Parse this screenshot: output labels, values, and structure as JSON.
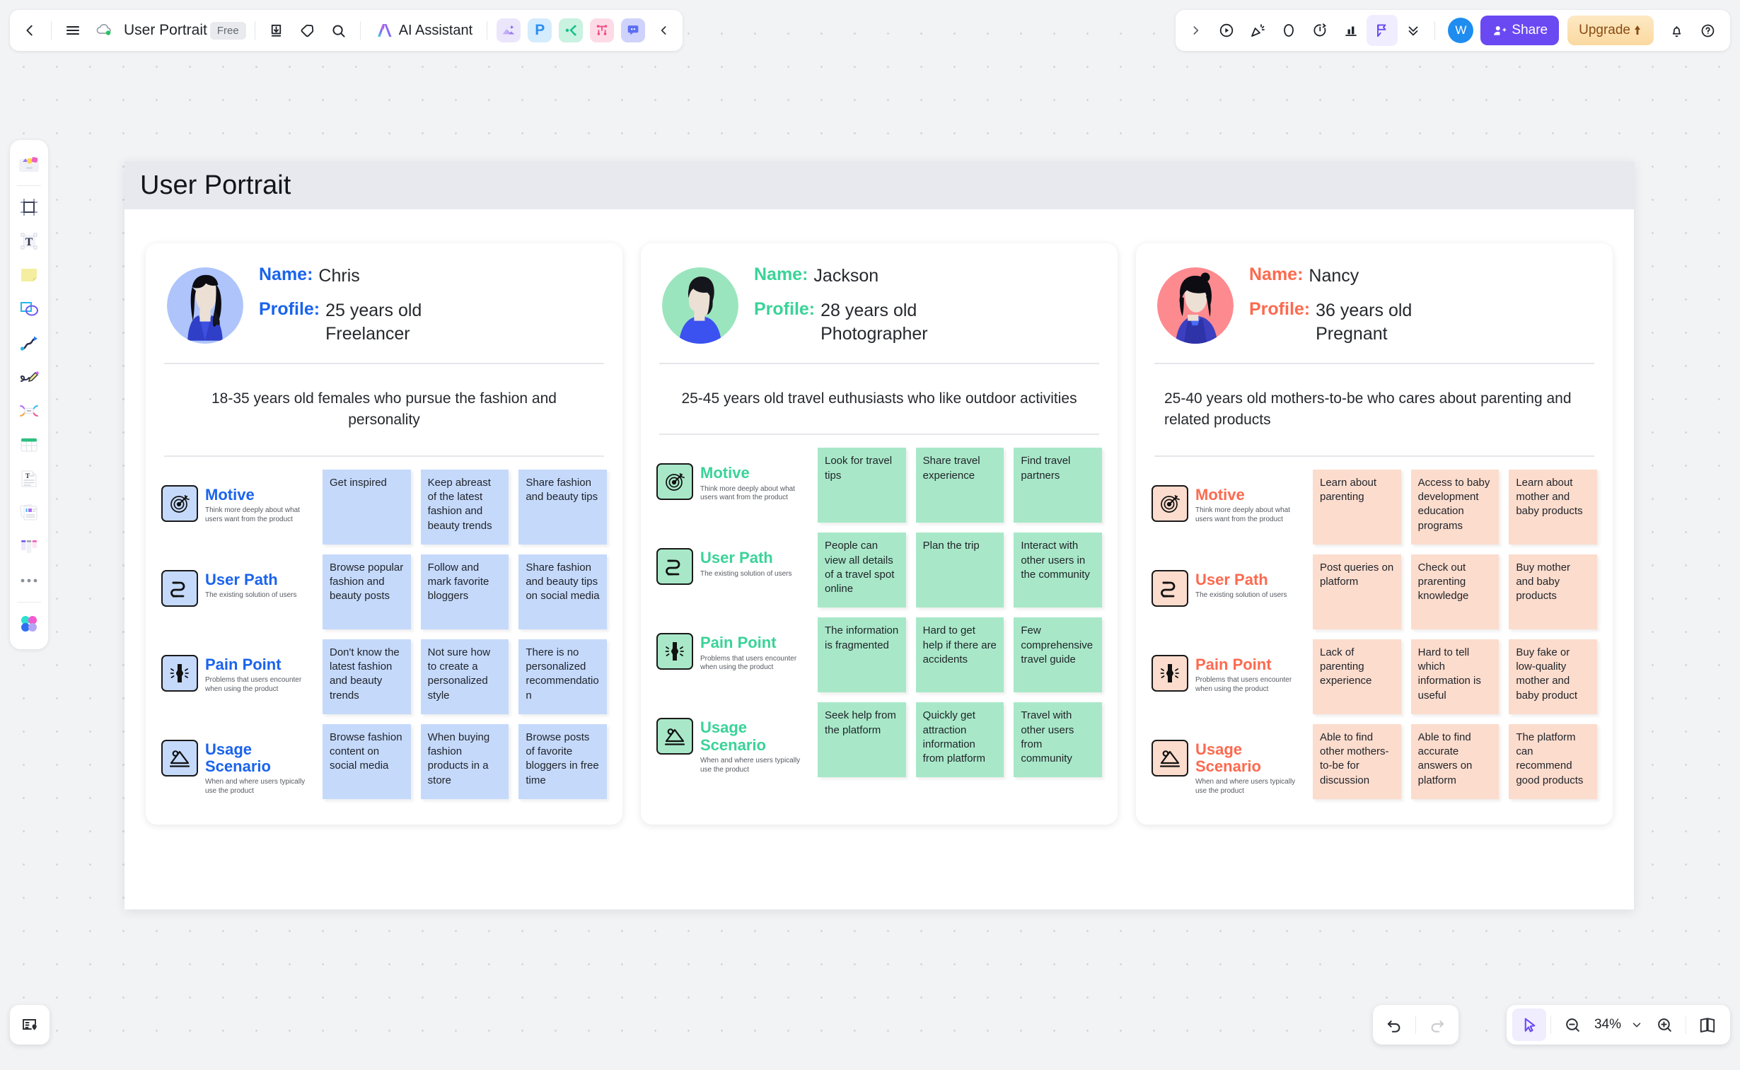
{
  "topbar": {
    "back_icon": "chevron-left-icon",
    "menu_icon": "hamburger-menu-icon",
    "cloud_icon": "cloud-sync-icon",
    "doc_title": "User Portrait",
    "plan_badge": "Free",
    "download_icon": "download-icon",
    "tag_icon": "tag-icon",
    "search_icon": "search-icon",
    "ai_assistant_label": "AI Assistant",
    "app_icons": [
      {
        "name": "image-app-icon",
        "bg": "#ece6fc",
        "glyph": "image"
      },
      {
        "name": "presentation-app-icon",
        "bg": "#d4ecfd",
        "glyph": "P"
      },
      {
        "name": "mindmap-app-icon",
        "bg": "#c9f2e0",
        "glyph": "mindmap"
      },
      {
        "name": "flowchart-app-icon",
        "bg": "#fcdbe6",
        "glyph": "flow"
      },
      {
        "name": "comment-app-icon",
        "bg": "#cfd3fb",
        "glyph": "comment"
      }
    ],
    "collapse_icon": "chevron-left-icon",
    "expand_icon": "chevron-right-icon",
    "right_icons": [
      {
        "name": "present-icon"
      },
      {
        "name": "celebrate-icon"
      },
      {
        "name": "comment-bubble-icon"
      },
      {
        "name": "timer-icon"
      },
      {
        "name": "vote-icon"
      },
      {
        "name": "cursor-flag-icon"
      },
      {
        "name": "chevrons-down-icon"
      }
    ],
    "avatar_initial": "W",
    "avatar_color": "#1f8cf0",
    "share_label": "Share",
    "share_color": "#6a49f2",
    "upgrade_label": "Upgrade",
    "notification_icon": "bell-icon",
    "help_icon": "help-circle-icon"
  },
  "rail": {
    "items": [
      {
        "name": "rail-templates",
        "glyph": "templates"
      },
      {
        "name": "rail-frame",
        "glyph": "frame"
      },
      {
        "name": "rail-text",
        "glyph": "text"
      },
      {
        "name": "rail-sticky-note",
        "glyph": "sticky"
      },
      {
        "name": "rail-shapes",
        "glyph": "shapes"
      },
      {
        "name": "rail-connector",
        "glyph": "connector"
      },
      {
        "name": "rail-pen",
        "glyph": "pen"
      },
      {
        "name": "rail-mindmap",
        "glyph": "mindmap"
      },
      {
        "name": "rail-table",
        "glyph": "table"
      },
      {
        "name": "rail-doc",
        "glyph": "doc"
      },
      {
        "name": "rail-card",
        "glyph": "card"
      },
      {
        "name": "rail-kanban",
        "glyph": "kanban"
      },
      {
        "name": "rail-more",
        "glyph": "more"
      },
      {
        "name": "rail-plugins",
        "glyph": "plugins"
      }
    ]
  },
  "board": {
    "title": "User Portrait",
    "section_meta": [
      {
        "key": "motive",
        "title": "Motive",
        "sub": "Think more deeply about what users want from the product",
        "icon": "target-icon"
      },
      {
        "key": "path",
        "title": "User Path",
        "sub": "The existing solution of users",
        "icon": "route-icon"
      },
      {
        "key": "pain",
        "title": "Pain Point",
        "sub": "Problems that users encounter when using the product",
        "icon": "joint-pain-icon"
      },
      {
        "key": "usage",
        "title": "Usage Scenario",
        "sub": "When and where users typically use the product",
        "icon": "image-landscape-icon"
      }
    ],
    "name_label": "Name:",
    "profile_label": "Profile:",
    "personas": [
      {
        "id": "chris",
        "accent": "#1a63ed",
        "avatar_bg": "#aec4fb",
        "avatar_style": "female-long-hair",
        "name": "Chris",
        "profile": "25 years old\nFreelancer",
        "description": "18-35 years old females who pursue the fashion and personality",
        "note_bg": "#c5d9fb",
        "sections": {
          "motive": [
            "Get inspired",
            "Keep abreast of the latest fashion and beauty trends",
            "Share fashion and beauty tips"
          ],
          "path": [
            "Browse popular fashion and beauty posts",
            "Follow and mark favorite bloggers",
            "Share fashion and beauty tips on social media"
          ],
          "pain": [
            "Don't know the latest fashion and beauty trends",
            "Not sure how to create a personalized style",
            "There is no personalized recommendation"
          ],
          "usage": [
            "Browse fashion content on social media",
            "When buying fashion products in a store",
            "Browse posts of favorite bloggers in free time"
          ]
        }
      },
      {
        "id": "jackson",
        "accent": "#3ad398",
        "avatar_bg": "#9ae5bd",
        "avatar_style": "male-short-hair",
        "name": "Jackson",
        "profile": "28 years old\nPhotographer",
        "description": "25-45 years old travel euthusiasts who like outdoor activities",
        "note_bg": "#a8e8c8",
        "sections": {
          "motive": [
            "Look for travel tips",
            "Share travel experience",
            "Find travel partners"
          ],
          "path": [
            "People can view all details of a travel spot online",
            "Plan the trip",
            "Interact with other users in the community"
          ],
          "pain": [
            "The information is fragmented",
            "Hard to get help if there are accidents",
            "Few comprehensive travel guide"
          ],
          "usage": [
            "Seek help from the platform",
            "Quickly get attraction information from platform",
            "Travel with other users from community"
          ]
        }
      },
      {
        "id": "nancy",
        "accent": "#fc6a4f",
        "avatar_bg": "#fd8a8f",
        "avatar_style": "female-bob-hair",
        "name": "Nancy",
        "profile": "36 years old\nPregnant",
        "description": "25-40 years old mothers-to-be who cares about parenting and related products",
        "note_bg": "#fcdccd",
        "sections": {
          "motive": [
            "Learn about parenting",
            "Access to baby development education programs",
            "Learn about mother and baby products"
          ],
          "path": [
            "Post queries on platform",
            "Check out prarenting knowledge",
            "Buy mother and baby products"
          ],
          "pain": [
            "Lack of parenting experience",
            "Hard to tell which information is useful",
            "Buy fake or low-quality mother and baby product"
          ],
          "usage": [
            "Able to find other mothers-to-be for discussion",
            "Able to find accurate answers on platform",
            "The platform can recommend good products"
          ]
        }
      }
    ]
  },
  "bottombar": {
    "minimap_icon": "minimap-icon",
    "undo_icon": "undo-icon",
    "redo_icon": "redo-icon",
    "cursor_icon": "cursor-select-icon",
    "zoom_out_icon": "zoom-out-icon",
    "zoom_level": "34%",
    "zoom_dropdown_icon": "chevron-down-icon",
    "zoom_in_icon": "zoom-in-icon",
    "pages_icon": "pages-book-icon"
  }
}
